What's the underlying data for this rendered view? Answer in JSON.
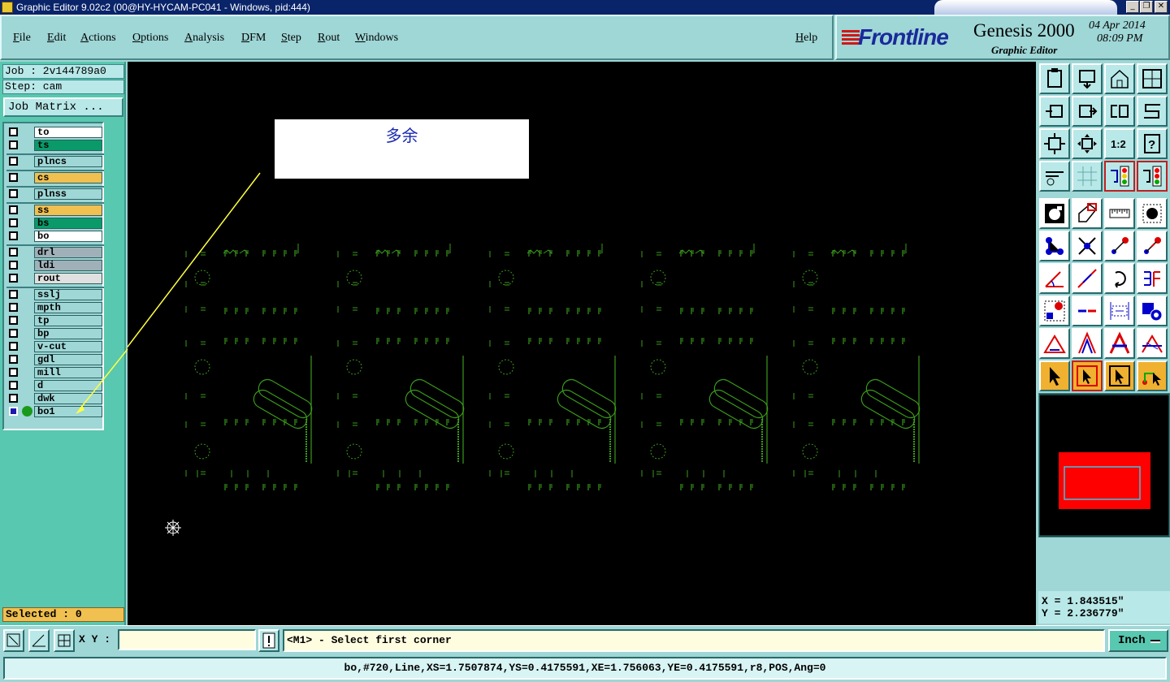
{
  "window": {
    "title": "Graphic Editor 9.02c2 (00@HY-HYCAM-PC041 - Windows, pid:444)",
    "controls": [
      "_",
      "❐",
      "✕"
    ]
  },
  "menu": {
    "items": [
      "File",
      "Edit",
      "Actions",
      "Options",
      "Analysis",
      "DFM",
      "Step",
      "Rout",
      "Windows"
    ],
    "help": "Help"
  },
  "brand": {
    "logo": "Frontline",
    "product": "Genesis 2000",
    "subtitle": "Graphic Editor",
    "date": "04 Apr 2014",
    "time": "08:09 PM"
  },
  "job": {
    "job_label": "Job : 2v144789a0",
    "step_label": "Step: cam",
    "matrix_button": "Job Matrix ..."
  },
  "layers": [
    {
      "name": "to",
      "color": "#ffffff"
    },
    {
      "name": "ts",
      "color": "#0a9a6a"
    },
    {
      "name": "plncs",
      "color": "#9fd6d6"
    },
    {
      "name": "cs",
      "color": "#f0c050"
    },
    {
      "name": "plnss",
      "color": "#9fd6d6"
    },
    {
      "name": "ss",
      "color": "#f0c050"
    },
    {
      "name": "bs",
      "color": "#0a9a6a"
    },
    {
      "name": "bo",
      "color": "#ffffff"
    },
    {
      "name": "drl",
      "color": "#a0b0b8"
    },
    {
      "name": "ldi",
      "color": "#a0b0b8"
    },
    {
      "name": "rout",
      "color": "#e0e0e0"
    },
    {
      "name": "sslj",
      "color": "#9fd6d6"
    },
    {
      "name": "mpth",
      "color": "#9fd6d6"
    },
    {
      "name": "tp",
      "color": "#9fd6d6"
    },
    {
      "name": "bp",
      "color": "#9fd6d6"
    },
    {
      "name": "v-cut",
      "color": "#9fd6d6"
    },
    {
      "name": "gdl",
      "color": "#9fd6d6"
    },
    {
      "name": "mill",
      "color": "#9fd6d6"
    },
    {
      "name": "d",
      "color": "#9fd6d6"
    },
    {
      "name": "dwk",
      "color": "#9fd6d6"
    },
    {
      "name": "bo1",
      "color": "#9fd6d6",
      "active": true
    }
  ],
  "selected": "Selected : 0",
  "annotation": "多余",
  "coords": {
    "x": "X = 1.843515\"",
    "y": "Y = 2.236779\""
  },
  "bottom": {
    "xy_label": "X Y :",
    "xy_value": "",
    "prompt": "<M1> - Select first corner",
    "units": "Inch"
  },
  "status": "bo,#720,Line,XS=1.7507874,YS=0.4175591,XE=1.756063,YE=0.4175591,r8,POS,Ang=0",
  "colors": {
    "canvas": "#000000",
    "features": "#3a9a1a",
    "annotation_arrow": "#ffff40",
    "overview_step": "#ff0000"
  },
  "tools": [
    "zoom-home-icon",
    "zoom-page-icon",
    "home-icon",
    "split-window-icon",
    "pan-left-icon",
    "pan-right-icon",
    "flip-icon",
    "snake-icon",
    "fit-icon",
    "center-icon",
    "scale-1-2-icon",
    "help-icon",
    "tools-icon",
    "grid-icon",
    "traffic-light-icon",
    "traffic-light-red-icon",
    "pad-icon",
    "polygon-icon",
    "ruler-icon",
    "dot-icon",
    "connect-icon",
    "cross-icon",
    "snap-icon",
    "measure-icon",
    "angle-icon",
    "line-icon",
    "rotate-icon",
    "mirror-icon",
    "feature-icon",
    "minus-icon",
    "dimension-icon",
    "circles-icon",
    "triangle-icon",
    "triangle-a-icon",
    "triangle-b-icon",
    "triangle-c-icon",
    "pointer-icon",
    "pointer-box-icon",
    "pointer-frame-icon",
    "pointer-path-icon"
  ]
}
